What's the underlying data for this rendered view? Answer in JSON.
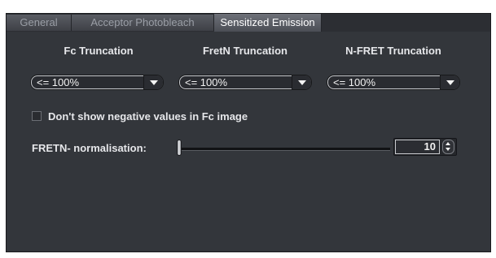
{
  "tabs": [
    {
      "label": "General",
      "active": false
    },
    {
      "label": "Acceptor Photobleach",
      "active": false
    },
    {
      "label": "Sensitized Emission",
      "active": true
    }
  ],
  "columns": {
    "fc": {
      "header": "Fc Truncation",
      "value": "<= 100%"
    },
    "fretn": {
      "header": "FretN Truncation",
      "value": "<= 100%"
    },
    "nfret": {
      "header": "N-FRET Truncation",
      "value": "<= 100%"
    }
  },
  "negative_values": {
    "label": "Don't show negative values in Fc image",
    "checked": false
  },
  "normalisation": {
    "label": "FRETN- normalisation:",
    "value": "10"
  },
  "icons": {
    "dropdown": "chevron-down-icon",
    "spin_up": "arrow-up-icon",
    "spin_down": "arrow-down-icon"
  },
  "colors": {
    "panel": "#33363b",
    "active_tab": "#5c5f66",
    "text": "#e6e7ea"
  }
}
